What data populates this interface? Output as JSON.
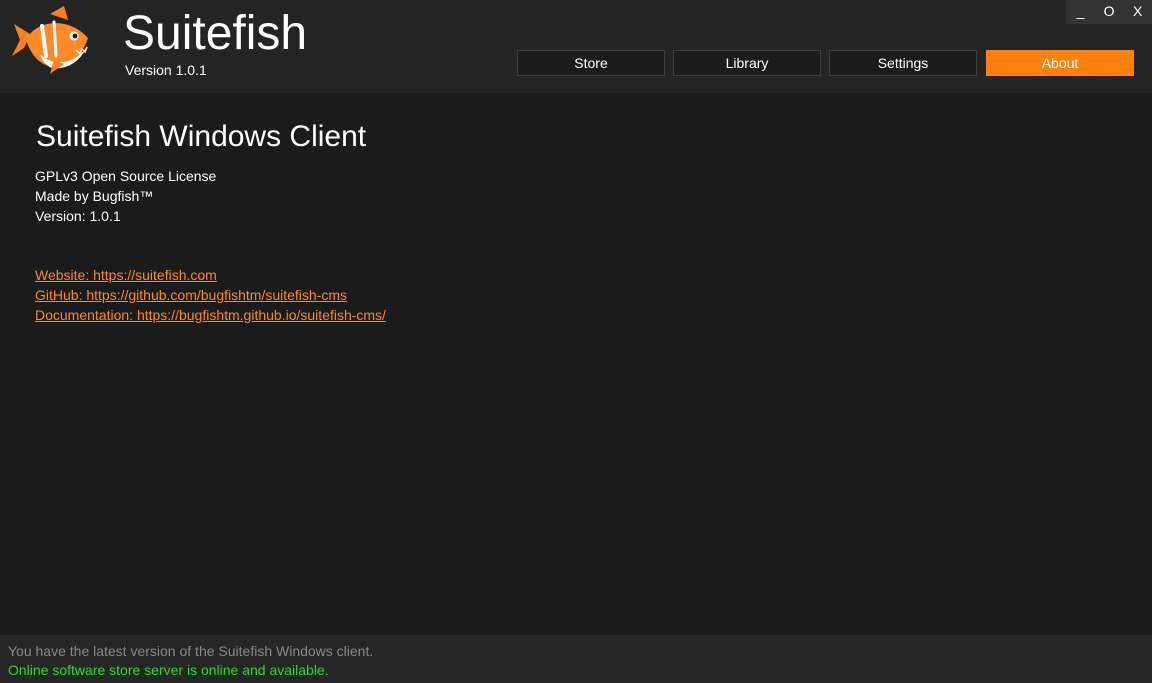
{
  "header": {
    "logo_icon": "fish-logo-icon",
    "title": "Suitefish",
    "version": "Version 1.0.1"
  },
  "window_controls": {
    "minimize": "_",
    "maximize": "O",
    "close": "X"
  },
  "nav": {
    "items": [
      {
        "label": "Store"
      },
      {
        "label": "Library"
      },
      {
        "label": "Settings"
      },
      {
        "label": "About"
      }
    ],
    "active": "About"
  },
  "about": {
    "title": "Suitefish Windows Client",
    "license": "GPLv3 Open Source License",
    "author": "Made by Bugfish™",
    "version": "Version: 1.0.1",
    "links": {
      "website": "Website: https://suitefish.com",
      "github": "GitHub: https://github.com/bugfishtm/suitefish-cms",
      "documentation": "Documentation: https://bugfishtm.github.io/suitefish-cms/"
    }
  },
  "status": {
    "update_message": "You have the latest version of the Suitefish Windows client.",
    "server_message": "Online software store server is online and available."
  },
  "colors": {
    "accent": "#ff7f0f",
    "link": "#ff8a1f",
    "status_ok": "#2bdc2b",
    "background": "#1b1b1b",
    "header_background": "#242424"
  }
}
